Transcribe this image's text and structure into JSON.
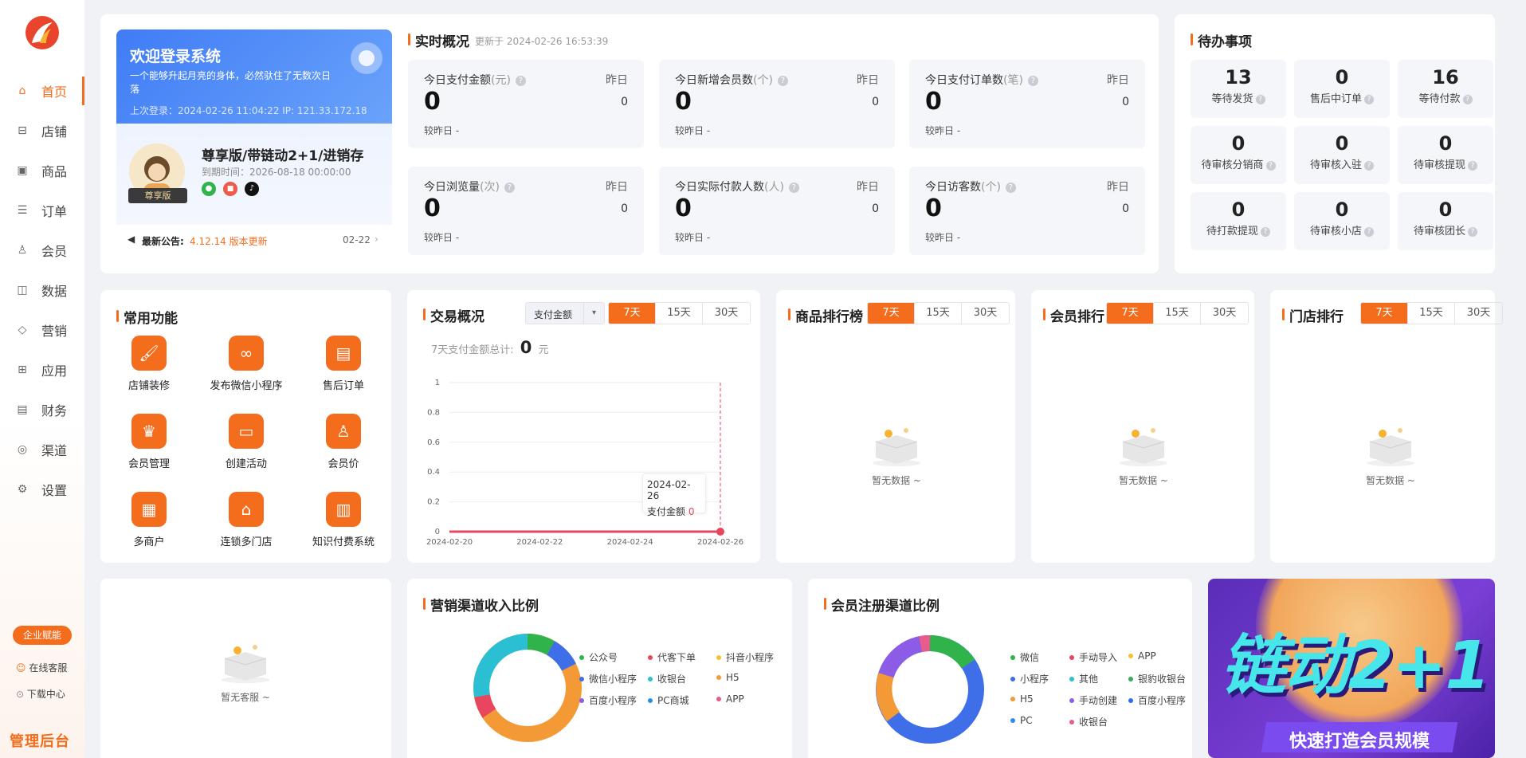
{
  "sidebar": {
    "items": [
      {
        "label": "首页",
        "icon": "home-icon"
      },
      {
        "label": "店铺",
        "icon": "shop-icon"
      },
      {
        "label": "商品",
        "icon": "goods-icon"
      },
      {
        "label": "订单",
        "icon": "order-icon"
      },
      {
        "label": "会员",
        "icon": "member-icon"
      },
      {
        "label": "数据",
        "icon": "data-icon"
      },
      {
        "label": "营销",
        "icon": "tag-icon"
      },
      {
        "label": "应用",
        "icon": "app-icon"
      },
      {
        "label": "财务",
        "icon": "finance-icon"
      },
      {
        "label": "渠道",
        "icon": "channel-icon"
      },
      {
        "label": "设置",
        "icon": "gear-icon"
      }
    ],
    "enterprise_badge": "企业赋能",
    "online_service": "在线客服",
    "download_center": "下载中心",
    "footer_title": "管理后台"
  },
  "welcome": {
    "title": "欢迎登录系统",
    "slogan": "一个能够升起月亮的身体，必然驮住了无数次日落",
    "last_login": "上次登录：2024-02-26 11:04:22 IP: 121.33.172.18",
    "edition": "尊享版/带链动2+1/进销存",
    "expire": "到期时间：2026-08-18 00:00:00",
    "badge": "尊享版",
    "notice_label": "最新公告:",
    "notice_text": "4.12.14 版本更新",
    "notice_date": "02-22"
  },
  "realtime": {
    "title": "实时概况",
    "updated": "更新于 2024-02-26 16:53:39",
    "yesterday_label": "昨日",
    "compare_label": "较昨日 -",
    "stats": [
      {
        "label": "今日支付金额",
        "unit": "(元)",
        "value": "0",
        "yesterday": "0"
      },
      {
        "label": "今日新增会员数",
        "unit": "(个)",
        "value": "0",
        "yesterday": "0"
      },
      {
        "label": "今日支付订单数",
        "unit": "(笔)",
        "value": "0",
        "yesterday": "0"
      },
      {
        "label": "今日浏览量",
        "unit": "(次)",
        "value": "0",
        "yesterday": "0"
      },
      {
        "label": "今日实际付款人数",
        "unit": "(人)",
        "value": "0",
        "yesterday": "0"
      },
      {
        "label": "今日访客数",
        "unit": "(个)",
        "value": "0",
        "yesterday": "0"
      }
    ]
  },
  "todo": {
    "title": "待办事项",
    "items": [
      {
        "count": "13",
        "label": "等待发货"
      },
      {
        "count": "0",
        "label": "售后中订单"
      },
      {
        "count": "16",
        "label": "等待付款"
      },
      {
        "count": "0",
        "label": "待审核分销商"
      },
      {
        "count": "0",
        "label": "待审核入驻"
      },
      {
        "count": "0",
        "label": "待审核提现"
      },
      {
        "count": "0",
        "label": "待打款提现"
      },
      {
        "count": "0",
        "label": "待审核小店"
      },
      {
        "count": "0",
        "label": "待审核团长"
      }
    ]
  },
  "functions": {
    "title": "常用功能",
    "items": [
      {
        "label": "店铺装修",
        "icon": "paint-roller-icon"
      },
      {
        "label": "发布微信小程序",
        "icon": "miniprogram-icon"
      },
      {
        "label": "售后订单",
        "icon": "after-sale-icon"
      },
      {
        "label": "会员管理",
        "icon": "crown-icon"
      },
      {
        "label": "创建活动",
        "icon": "ticket-icon"
      },
      {
        "label": "会员价",
        "icon": "member-price-icon"
      },
      {
        "label": "多商户",
        "icon": "store-icon"
      },
      {
        "label": "连锁多门店",
        "icon": "chain-store-icon"
      },
      {
        "label": "知识付费系统",
        "icon": "book-icon"
      }
    ]
  },
  "trade": {
    "title": "交易概况",
    "select_value": "支付金额",
    "tabs": [
      "7天",
      "15天",
      "30天"
    ],
    "total_label": "7天支付金额总计:",
    "total_value": "0",
    "total_unit": "元",
    "tooltip_date": "2024-02-26",
    "tooltip_label": "支付金额",
    "tooltip_value": "0"
  },
  "chart_data": {
    "type": "line",
    "x": [
      "2024-02-20",
      "2024-02-21",
      "2024-02-22",
      "2024-02-23",
      "2024-02-24",
      "2024-02-25",
      "2024-02-26"
    ],
    "x_tick_labels": [
      "2024-02-20",
      "2024-02-22",
      "2024-02-24",
      "2024-02-26"
    ],
    "series": [
      {
        "name": "支付金额",
        "values": [
          0,
          0,
          0,
          0,
          0,
          0,
          0
        ]
      }
    ],
    "y_ticks": [
      "0",
      "0.2",
      "0.4",
      "0.6",
      "0.8",
      "1"
    ],
    "ylim": [
      0,
      1
    ],
    "line_color": "#e8455f"
  },
  "goods_rank": {
    "title": "商品排行榜",
    "tabs": [
      "7天",
      "15天",
      "30天"
    ],
    "empty": "暂无数据 ~"
  },
  "member_rank": {
    "title": "会员排行",
    "tabs": [
      "7天",
      "15天",
      "30天"
    ],
    "empty": "暂无数据 ~"
  },
  "store_rank": {
    "title": "门店排行",
    "tabs": [
      "7天",
      "15天",
      "30天"
    ],
    "empty": "暂无数据 ~"
  },
  "service": {
    "empty": "暂无客服 ~"
  },
  "marketing_channel": {
    "title": "营销渠道收入比例",
    "legend": [
      {
        "label": "公众号",
        "color": "#2fb34a"
      },
      {
        "label": "代客下单",
        "color": "#e8455f"
      },
      {
        "label": "抖音小程序",
        "color": "#f2c230"
      },
      {
        "label": "微信小程序",
        "color": "#3f6fe8"
      },
      {
        "label": "收银台",
        "color": "#2bbfd4"
      },
      {
        "label": "H5",
        "color": "#f39a36"
      },
      {
        "label": "百度小程序",
        "color": "#8c5ce6"
      },
      {
        "label": "PC商城",
        "color": "#2b8cf0"
      },
      {
        "label": "APP",
        "color": "#e85c8c"
      }
    ]
  },
  "member_channel": {
    "title": "会员注册渠道比例",
    "legend": [
      {
        "label": "微信",
        "color": "#2fb34a"
      },
      {
        "label": "手动导入",
        "color": "#e8455f"
      },
      {
        "label": "APP",
        "color": "#f2c230"
      },
      {
        "label": "小程序",
        "color": "#3f6fe8"
      },
      {
        "label": "其他",
        "color": "#2bbfd4"
      },
      {
        "label": "银豹收银台",
        "color": "#3aaa5a"
      },
      {
        "label": "H5",
        "color": "#f39a36"
      },
      {
        "label": "手动创建",
        "color": "#8c5ce6"
      },
      {
        "label": "百度小程序",
        "color": "#2b6cf0"
      },
      {
        "label": "PC",
        "color": "#2b8cf0"
      },
      {
        "label": "收银台",
        "color": "#e85c8c"
      }
    ]
  },
  "banner": {
    "headline": "链动2+1",
    "subline": "快速打造会员规模"
  }
}
